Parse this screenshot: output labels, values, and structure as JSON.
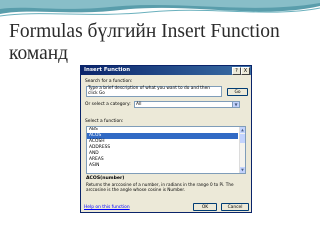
{
  "slide": {
    "title": "Formulas бүлгийн Insert Function команд"
  },
  "dialog": {
    "title": "Insert Function",
    "help_glyph": "?",
    "close_glyph": "X",
    "search_label": "Search for a function:",
    "search_value": "Type a brief description of what you want to do and then click Go",
    "go_label": "Go",
    "category_label": "Or select a category:",
    "category_value": "All",
    "function_label": "Select a function:",
    "functions": [
      "ABS",
      "ACOS",
      "ACOSH",
      "ADDRESS",
      "AND",
      "AREAS",
      "ASIN"
    ],
    "selected_function": "ACOS",
    "signature": "ACOS(number)",
    "description": "Returns the arccosine of a number, in radians in the range 0 to Pi. The arccosine is the angle whose cosine is Number.",
    "help_link": "Help on this function",
    "ok_label": "OK",
    "cancel_label": "Cancel"
  },
  "colors": {
    "titlebar": "#0a246a",
    "selection": "#316ac5",
    "dialog_bg": "#ece9d8",
    "wave": "#3c8c9c",
    "link": "#0000ff"
  }
}
